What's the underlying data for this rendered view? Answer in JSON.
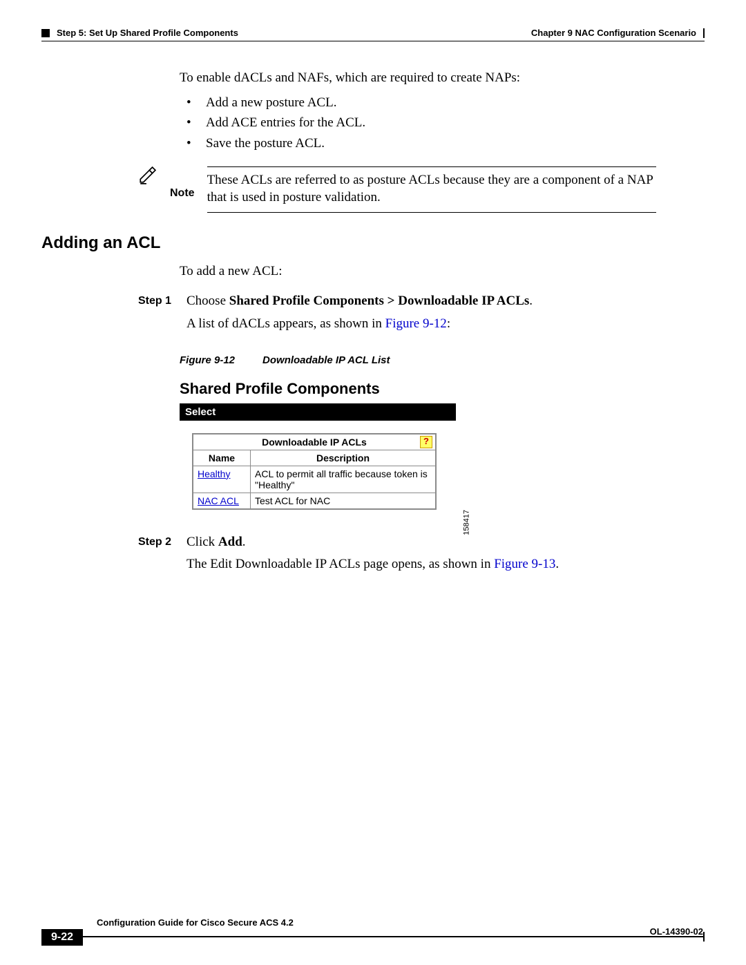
{
  "header": {
    "step_label": "Step 5: Set Up Shared Profile Components",
    "chapter_label": "Chapter 9    NAC Configuration Scenario"
  },
  "intro": {
    "lead": "To enable dACLs and NAFs, which are required to create NAPs:",
    "bullets": [
      "Add a new posture ACL.",
      "Add ACE entries for the ACL.",
      "Save the posture ACL."
    ]
  },
  "note": {
    "label": "Note",
    "text": "These ACLs are referred to as posture ACLs because they are a component of a NAP that is used in posture validation."
  },
  "section": {
    "heading": "Adding an ACL",
    "intro": "To add a new ACL:"
  },
  "steps": [
    {
      "label": "Step 1",
      "line1_a": "Choose ",
      "line1_b": "Shared Profile Components > Downloadable IP ACLs",
      "line1_c": ".",
      "line2_a": "A list of dACLs appears, as shown in ",
      "line2_link": "Figure 9-12",
      "line2_b": ":"
    },
    {
      "label": "Step 2",
      "line1_a": "Click ",
      "line1_b": "Add",
      "line1_c": ".",
      "line2_a": "The Edit Downloadable IP ACLs page opens, as shown in ",
      "line2_link": "Figure 9-13",
      "line2_b": "."
    }
  ],
  "figure": {
    "num": "Figure 9-12",
    "title": "Downloadable IP ACL List",
    "side_id": "158417"
  },
  "screenshot": {
    "title": "Shared Profile Components",
    "select_bar": "Select",
    "table_title": "Downloadable IP ACLs",
    "help": "?",
    "col_name": "Name",
    "col_desc": "Description",
    "rows": [
      {
        "name": "Healthy",
        "desc": "ACL to permit all traffic because token is \"Healthy\""
      },
      {
        "name": "NAC ACL",
        "desc": "Test ACL for NAC"
      }
    ]
  },
  "footer": {
    "guide": "Configuration Guide for Cisco Secure ACS 4.2",
    "page": "9-22",
    "ol": "OL-14390-02"
  }
}
